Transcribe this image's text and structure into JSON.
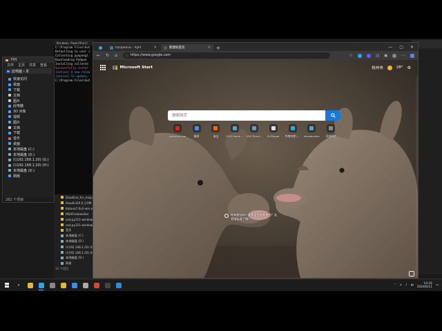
{
  "browser": {
    "tabs": [
      {
        "label": "",
        "icon": "edge-icon"
      },
      {
        "label": "PyOpenGL · PyPI",
        "icon": "pypi-icon"
      },
      {
        "label": "新建标签页",
        "icon": "newtab-icon"
      }
    ],
    "new_tab_symbol": "+",
    "window_controls": [
      "—",
      "▢",
      "✕"
    ],
    "url": "https://www.google.com",
    "nav": {
      "back": "←",
      "forward": "→",
      "refresh": "↻",
      "home": "⌂"
    }
  },
  "newtab": {
    "brand": "Microsoft Start",
    "location": "杭州市",
    "temperature": "28°",
    "search_placeholder": "搜索网页",
    "quick_links": [
      {
        "label": "youtube.com",
        "color": "#e62117"
      },
      {
        "label": "翻译",
        "color": "#4a8cf7"
      },
      {
        "label": "淘宝",
        "color": "#ff6a00"
      },
      {
        "label": "USD Home ...",
        "color": "#5aa0c8"
      },
      {
        "label": "USD Termi...",
        "color": "#5aa0c8"
      },
      {
        "label": "EdiTarget",
        "color": "#dddddd"
      },
      {
        "label": "哔哩哔哩 |...",
        "color": "#23ade5"
      },
      {
        "label": "Introduction",
        "color": "#5aa0c8"
      },
      {
        "label": "添加网站",
        "color": "#888888"
      }
    ],
    "caption": "你有想法吗？你是否会吃的东西？这是啥标准了哦？"
  },
  "explorer": {
    "title": "FIH",
    "menu": [
      "文件",
      "主页",
      "共享",
      "查看"
    ],
    "address": "此电脑 › 本",
    "tree": [
      {
        "label": "快速访问",
        "color": "#4aa3ff"
      },
      {
        "label": "桌面",
        "color": "#4aa3ff"
      },
      {
        "label": "下载",
        "color": "#4aa3ff"
      },
      {
        "label": "文档",
        "color": "#cccccc"
      },
      {
        "label": "图片",
        "color": "#cccccc"
      },
      {
        "label": "此电脑",
        "color": "#4aa3ff"
      },
      {
        "label": "3D 对象",
        "color": "#4aa3ff"
      },
      {
        "label": "视频",
        "color": "#4aa3ff"
      },
      {
        "label": "图片",
        "color": "#4aa3ff"
      },
      {
        "label": "文档",
        "color": "#cccccc"
      },
      {
        "label": "下载",
        "color": "#4aa3ff"
      },
      {
        "label": "音乐",
        "color": "#e06060"
      },
      {
        "label": "桌面",
        "color": "#4aa3ff"
      },
      {
        "label": "本地磁盘 (C:)",
        "color": "#8aaabb"
      },
      {
        "label": "本地磁盘 (D:)",
        "color": "#8aaabb"
      },
      {
        "label": "(\\\\192.168.1.20) (G:)",
        "color": "#8aaabb"
      },
      {
        "label": "(\\\\192.168.1.20) (H:)",
        "color": "#8aaabb"
      },
      {
        "label": "本地磁盘 (D:)",
        "color": "#8aaabb"
      },
      {
        "label": "网络",
        "color": "#4aa3ff"
      }
    ],
    "status": "282 个项目"
  },
  "terminal": {
    "tab": "Windows PowerShell",
    "lines": [
      {
        "text": "C:\\Program Files\\Aut",
        "cls": ""
      },
      {
        "text": "Defaulting to user i",
        "cls": ""
      },
      {
        "text": "Collecting pyopengl",
        "cls": ""
      },
      {
        "text": "  Downloading PyOpen",
        "cls": ""
      },
      {
        "text": "",
        "cls": ""
      },
      {
        "text": "Installing collecte",
        "cls": ""
      },
      {
        "text": "Successfully instal",
        "cls": "red"
      },
      {
        "text": "[notice] A new relea",
        "cls": "blue"
      },
      {
        "text": "[notice] To update,",
        "cls": "blue"
      },
      {
        "text": "",
        "cls": ""
      },
      {
        "text": "C:\\Program Files\\Aut",
        "cls": ""
      }
    ]
  },
  "explorer2": {
    "files": [
      {
        "label": "Deadline_for_maya",
        "type": "folder"
      },
      {
        "label": "Houdini20.0_COM",
        "type": "folder"
      },
      {
        "label": "Katana7.0v2-win-x",
        "type": "folder"
      },
      {
        "label": "MSAFirebaseSer",
        "type": "folder"
      },
      {
        "label": "usd.py311-windows",
        "type": "folder"
      },
      {
        "label": "usd.py311-windows",
        "type": "folder"
      },
      {
        "label": "音乐",
        "type": "folder"
      },
      {
        "label": "本地磁盘 (C:)",
        "type": "drive"
      },
      {
        "label": "本地磁盘 (D:)",
        "type": "drive"
      },
      {
        "label": "(\\\\192.168.1.20) (G:)",
        "type": "drive"
      },
      {
        "label": "(\\\\192.168.1.20) (H:)",
        "type": "drive"
      },
      {
        "label": "本地磁盘 (D:)",
        "type": "drive"
      },
      {
        "label": "网络",
        "type": "drive"
      }
    ],
    "status": "15 个项目"
  },
  "taskbar": {
    "apps": [
      {
        "name": "explorer",
        "color": "#e0b84a",
        "active": false
      },
      {
        "name": "edge",
        "color": "#2fa7e0",
        "active": true
      },
      {
        "name": "settings",
        "color": "#888888",
        "active": false
      },
      {
        "name": "files",
        "color": "#e0b84a",
        "active": false
      },
      {
        "name": "store",
        "color": "#3b8ee8",
        "active": false
      },
      {
        "name": "mail",
        "color": "#aaaaaa",
        "active": false
      },
      {
        "name": "chrome",
        "color": "#d9443a",
        "active": false
      },
      {
        "name": "terminal",
        "color": "#444444",
        "active": false
      },
      {
        "name": "vscode",
        "color": "#2a8fd8",
        "active": false
      }
    ],
    "time": "14:16",
    "date": "2024/6/11",
    "search_symbol": "⌕"
  },
  "colors": {
    "accent": "#1a78d6",
    "ms_red": "#f25022",
    "ms_green": "#7fba00",
    "ms_blue": "#00a4ef",
    "ms_yellow": "#ffb900"
  }
}
